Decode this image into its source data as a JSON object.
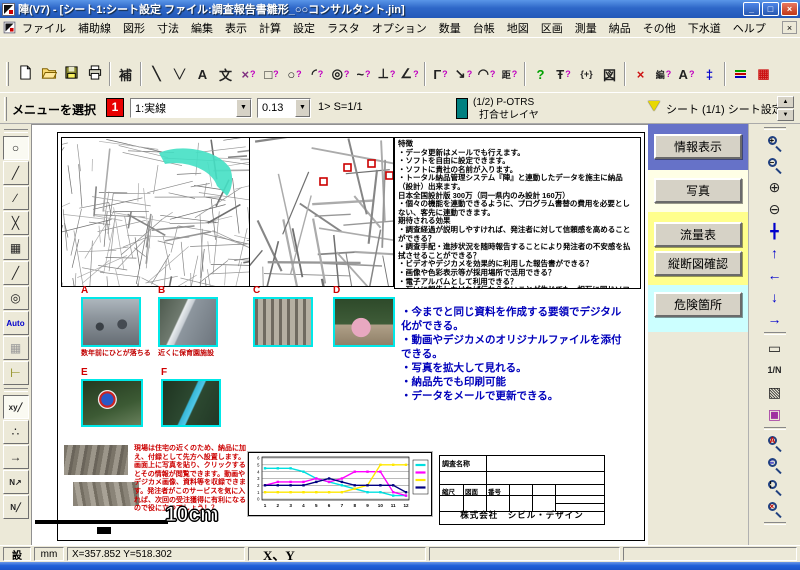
{
  "window": {
    "title": "陣(V7) - [シート1:シート設定  ファイル:調査報告書雛形_○○コンサルタント.jin]",
    "controls": {
      "minimize": "_",
      "restore": "□",
      "close": "×"
    }
  },
  "menubar": {
    "items": [
      "ファイル",
      "補助線",
      "図形",
      "寸法",
      "編集",
      "表示",
      "計算",
      "設定",
      "ラスタ",
      "オプション",
      "数量",
      "台帳",
      "地図",
      "区画",
      "測量",
      "納品",
      "その他",
      "下水道",
      "ヘルプ"
    ],
    "close_glyph": "×"
  },
  "toolbar_main": {
    "buttons": [
      {
        "name": "new-file",
        "icon": "new"
      },
      {
        "name": "open-file",
        "icon": "open"
      },
      {
        "name": "save-file",
        "icon": "save"
      },
      {
        "name": "print-file",
        "icon": "print"
      },
      {
        "sep": true
      },
      {
        "name": "auxiliary-line-mode",
        "glyph": "補"
      },
      {
        "sep": true
      },
      {
        "name": "draw-line",
        "glyph": "╲"
      },
      {
        "name": "draw-polyline",
        "glyph": "╲╱",
        "small": true
      },
      {
        "name": "draw-text",
        "glyph": "A"
      },
      {
        "name": "draw-text-jp",
        "glyph": "文"
      },
      {
        "name": "erase-point",
        "glyph": "×",
        "q": true,
        "color": "#803080"
      },
      {
        "name": "draw-rect",
        "glyph": "□",
        "q": true
      },
      {
        "name": "draw-circle",
        "glyph": "○",
        "q": true
      },
      {
        "name": "draw-arc",
        "glyph": "◜",
        "q": true
      },
      {
        "name": "draw-ellipse",
        "glyph": "◎",
        "q": true
      },
      {
        "name": "draw-spline",
        "glyph": "~",
        "q": true
      },
      {
        "name": "draw-perpendicular",
        "glyph": "⊥",
        "q": true
      },
      {
        "name": "draw-chamfer",
        "glyph": "∠",
        "q": true
      },
      {
        "sep": true
      },
      {
        "name": "edit-fillet",
        "glyph": "Γ",
        "q": true
      },
      {
        "name": "edit-extend",
        "glyph": "↘",
        "q": true
      },
      {
        "name": "edit-cloud",
        "glyph": "◠",
        "q": true
      },
      {
        "name": "measure-distance",
        "glyph": "距",
        "q": true,
        "small": true
      },
      {
        "sep": true
      },
      {
        "name": "help-query",
        "glyph": "?",
        "color": "#00A000"
      },
      {
        "name": "datum-point",
        "glyph": "Ŧ",
        "q": true
      },
      {
        "name": "group-brackets",
        "glyph": "{+}",
        "small": true
      },
      {
        "name": "figure-insert",
        "glyph": "図"
      },
      {
        "sep": true
      },
      {
        "name": "delete-element",
        "glyph": "×",
        "color": "#CC1111"
      },
      {
        "name": "edit-element",
        "glyph": "編",
        "q": true,
        "small": true
      },
      {
        "name": "edit-text",
        "glyph": "A",
        "q": true
      },
      {
        "name": "move-point",
        "glyph": "‡",
        "color": "#0000CC"
      },
      {
        "sep": true
      },
      {
        "name": "layer-list",
        "icon": "bars"
      },
      {
        "name": "table-tool",
        "glyph": "▦",
        "color": "#CC1111"
      }
    ]
  },
  "toolbar_select": {
    "label": "メニューを選択",
    "number": "1",
    "line_type": "1:実線",
    "line_width": "0.13",
    "scale": "1> S=1/1",
    "layer_color": "#008080",
    "layer_line1": "(1/2) P-OTRS",
    "layer_line2": "打合せレイヤ",
    "sheet_label": "シート (1/1) シート設定",
    "spin_up": "▲",
    "spin_down": "▼"
  },
  "tool_palette": {
    "tools": [
      {
        "name": "snap-free",
        "glyph": "○",
        "active": true
      },
      {
        "name": "snap-endpoint",
        "glyph": "╱"
      },
      {
        "name": "snap-online",
        "glyph": "∕"
      },
      {
        "name": "snap-intersection",
        "glyph": "╳"
      },
      {
        "name": "snap-grid",
        "glyph": "▦"
      },
      {
        "name": "snap-nearest",
        "glyph": "╱"
      },
      {
        "name": "snap-center",
        "glyph": "◎"
      },
      {
        "name": "snap-auto",
        "glyph": "Auto",
        "small": true,
        "color": "#0000CC"
      },
      {
        "name": "grid-toggle",
        "glyph": "▦",
        "color": "#999999"
      },
      {
        "name": "measure-mode",
        "glyph": "⊢",
        "color": "#808000"
      },
      {
        "sep": true
      },
      {
        "name": "input-xy",
        "glyph": "xy╱",
        "small": true,
        "active": true
      },
      {
        "name": "input-relative",
        "glyph": "∴"
      },
      {
        "name": "input-vector",
        "glyph": "→"
      },
      {
        "name": "input-north-arrow",
        "glyph": "N↗",
        "small": true
      },
      {
        "name": "input-north-line",
        "glyph": "N╱",
        "small": true
      }
    ]
  },
  "right_panel": {
    "sections": [
      {
        "name": "info",
        "bg": "#6672C8",
        "buttons": [
          {
            "name": "info-display-button",
            "label": "情報表示"
          }
        ]
      },
      {
        "name": "photo",
        "bg": "#FFFFE6",
        "buttons": [
          {
            "name": "photo-button",
            "label": "写真"
          }
        ]
      },
      {
        "name": "flow",
        "bg": "#FFFF8C",
        "buttons": [
          {
            "name": "flow-table-button",
            "label": "流量表"
          },
          {
            "name": "profile-check-button",
            "label": "縦断図確認"
          }
        ]
      },
      {
        "name": "danger",
        "bg": "#CCFFFF",
        "buttons": [
          {
            "name": "danger-spot-button",
            "label": "危険箇所"
          }
        ]
      }
    ]
  },
  "view_toolbar": {
    "tools": [
      {
        "name": "zoom-in",
        "icon": "mag",
        "ov": "+",
        "ovc": "#000000"
      },
      {
        "name": "zoom-out",
        "icon": "mag",
        "ov": "−",
        "ovc": "#000000"
      },
      {
        "name": "zoom-in-step",
        "glyph": "⊕"
      },
      {
        "name": "zoom-out-step",
        "glyph": "⊖"
      },
      {
        "name": "pan",
        "glyph": "╋",
        "color": "#0000CC"
      },
      {
        "name": "scroll-up",
        "glyph": "↑",
        "color": "#0000CC"
      },
      {
        "name": "scroll-left",
        "glyph": "←",
        "color": "#0000CC"
      },
      {
        "name": "scroll-down",
        "glyph": "↓",
        "color": "#0000CC"
      },
      {
        "name": "scroll-right",
        "glyph": "→",
        "color": "#0000CC"
      },
      {
        "sep": true
      },
      {
        "name": "zoom-window",
        "glyph": "▭"
      },
      {
        "name": "zoom-scale",
        "glyph": "1/N",
        "small": true
      },
      {
        "name": "redraw",
        "glyph": "▧"
      },
      {
        "name": "copy-image",
        "glyph": "▣",
        "color": "#A030A0"
      },
      {
        "sep": true
      },
      {
        "name": "search-text",
        "icon": "mag",
        "ov": "A",
        "ovc": "#C00000"
      },
      {
        "name": "search-layers",
        "icon": "mag",
        "ov": "≡",
        "ovc": "#0000C0"
      },
      {
        "name": "search-lines",
        "icon": "mag",
        "ov": "¦",
        "ovc": "#000000"
      },
      {
        "name": "search-remove",
        "icon": "mag",
        "ov": "×",
        "ovc": "#C00000"
      },
      {
        "sep": true
      }
    ]
  },
  "statusbar": {
    "mode": "設",
    "unit": "mm",
    "coords": "X=357.852 Y=518.302",
    "axis": "X、Y"
  },
  "document": {
    "notes_black": [
      "特徴",
      "・データ更新はメールでも行えます。",
      "・ソフトを自由に設定できます。",
      "・ソフトに貴社の名前が入ります。",
      "・トータル納品管理システム『陣』と連動したデータを施主に納品（設計）出来ます。",
      "日本全国設計版 300万（同一県内のみ設計 160万）",
      "・個々の機能を連動できるように、プログラム書替の費用を必要としない、客先に連動できます。",
      "期待される効果",
      "・調査経過が説明しやすければ、発注者に対して信頼感を高めることができる？",
      "・調査手配・進捗状況を随時報告することにより発注者の不安感を払拭させることができる？",
      "・ビデオやデジカメを効果的に利用した報告書ができる？",
      "・画像や色彩表示等が採用場所で活用できる？",
      "・電子アルバムとして利用できる？",
      "・互いに報告しなければ伝わらないことが生じても、相互に同じソフトがあるので伝えやすい？"
    ],
    "notes_blue": [
      "・今までと同じ資料を作成する要領でデジタル化ができる。",
      "・動画やデジカメのオリジナルファイルを添付できる。",
      "・写真を拡大して見れる。",
      "・納品先でも印刷可能",
      "・データをメールで更新できる。"
    ],
    "photo_items": [
      {
        "label": "A",
        "caption": "数年前にひとが落ちる"
      },
      {
        "label": "B",
        "caption": "近くに保育園施設"
      },
      {
        "label": "C",
        "caption": ""
      },
      {
        "label": "D",
        "caption": ""
      },
      {
        "label": "E",
        "caption": ""
      },
      {
        "label": "F",
        "caption": ""
      }
    ],
    "red_note": "現場は住宅の近くのため、納品に加え、付録として先方へ設置します。画面上に写真を貼り、クリックするとその情報が閲覧できます。動画やデジカメ画像、資料等を収録できます。発注者がこのサービスを気に入れば、次回の受注獲得に有利になるので役に立つでしょう！？",
    "scale_label": "10cm",
    "map_markers": [
      [
        70,
        40
      ],
      [
        94,
        26
      ],
      [
        118,
        22
      ],
      [
        136,
        34
      ],
      [
        146,
        46
      ],
      [
        152,
        86
      ]
    ],
    "title_block": {
      "name_label": "調査名称",
      "small_headers": [
        "縮尺",
        "図面",
        "番号"
      ],
      "company": "株式会社　シビル・デザイン"
    }
  },
  "colors": {
    "photo_border": "#00E8E8",
    "teal_highlight": "#44E0C4",
    "marker_red": "#CC0000",
    "layer_teal": "#008080"
  },
  "chart_data": {
    "type": "line",
    "title": "",
    "xlabel": "",
    "ylabel": "",
    "x": [
      1,
      2,
      3,
      4,
      5,
      6,
      7,
      8,
      9,
      10,
      11,
      12
    ],
    "ylim": [
      0,
      6
    ],
    "yticks": [
      0,
      1,
      2,
      3,
      4,
      5,
      6
    ],
    "grid": true,
    "legend_position": "right",
    "series": [
      {
        "name": "cyan",
        "color": "#00E0E0",
        "values": [
          4.5,
          4.5,
          4.5,
          4,
          3,
          2.5,
          2,
          1.5,
          1,
          1,
          0.5,
          0.5
        ]
      },
      {
        "name": "magenta",
        "color": "#FF00FF",
        "values": [
          2,
          2.5,
          2.5,
          2.5,
          3,
          2.5,
          3,
          4,
          4,
          4,
          1,
          0.5
        ]
      },
      {
        "name": "yellow",
        "color": "#FFE800",
        "values": [
          1,
          1,
          1,
          1,
          1,
          1,
          1,
          1.5,
          2,
          5,
          5,
          5
        ]
      },
      {
        "name": "navy",
        "color": "#000080",
        "values": [
          2,
          2,
          2,
          2,
          2.5,
          3,
          2.5,
          2,
          2,
          2,
          2,
          1
        ]
      }
    ]
  }
}
